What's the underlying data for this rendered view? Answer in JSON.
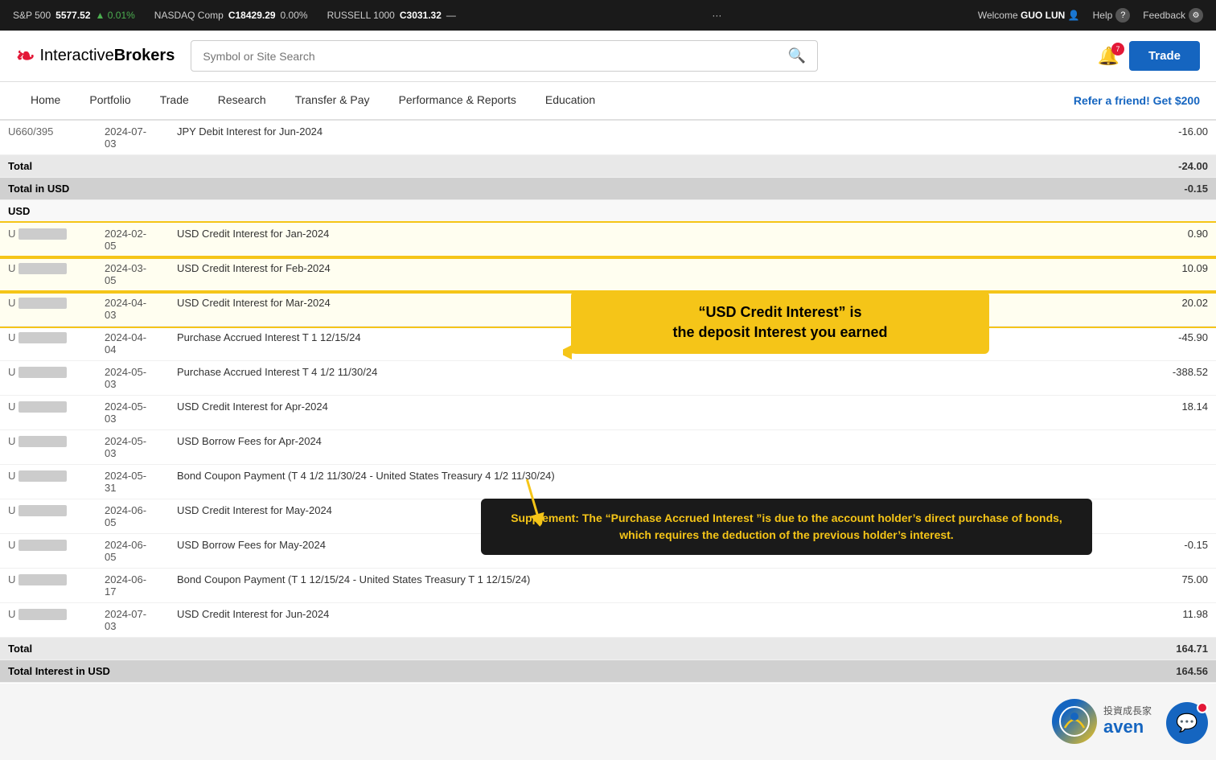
{
  "ticker": {
    "items": [
      {
        "label": "S&P 500",
        "value": "5577.52",
        "change": "▲ 0.01%",
        "change_type": "pos"
      },
      {
        "label": "NASDAQ Comp",
        "value": "C18429.29",
        "change": "0.00%",
        "change_type": "neu"
      },
      {
        "label": "RUSSELL 1000",
        "value": "C3031.32",
        "change": "—",
        "change_type": "neu"
      }
    ],
    "dots": "···",
    "welcome_prefix": "Welcome",
    "user": "GUO LUN",
    "help_label": "Help",
    "feedback_label": "Feedback"
  },
  "header": {
    "logo_text_light": "Interactive",
    "logo_text_bold": "Brokers",
    "search_placeholder": "Symbol or Site Search",
    "bell_badge": "7",
    "trade_button": "Trade"
  },
  "nav": {
    "items": [
      "Home",
      "Portfolio",
      "Trade",
      "Research",
      "Transfer & Pay",
      "Performance & Reports",
      "Education"
    ],
    "refer": "Refer a friend! Get $200"
  },
  "table": {
    "header_row1": {
      "id": "U660/395",
      "date": "2024-07-03",
      "desc": "JPY Debit Interest for Jun-2024",
      "amount": "-16.00"
    },
    "total_row": {
      "label": "Total",
      "amount": "-24.00"
    },
    "total_usd_row": {
      "label": "Total in USD",
      "amount": "-0.15"
    },
    "usd_section_label": "USD",
    "rows": [
      {
        "id_blurred": true,
        "id_prefix": "U",
        "date": "2024-02-05",
        "desc": "USD Credit Interest for Jan-2024",
        "amount": "0.90",
        "highlighted": true
      },
      {
        "id_blurred": true,
        "id_prefix": "U",
        "date": "2024-03-05",
        "desc": "USD Credit Interest for Feb-2024",
        "amount": "10.09",
        "highlighted": true
      },
      {
        "id_blurred": true,
        "id_prefix": "U",
        "date": "2024-04-03",
        "desc": "USD Credit Interest for Mar-2024",
        "amount": "20.02",
        "highlighted": true
      },
      {
        "id_blurred": true,
        "id_prefix": "U",
        "date": "2024-04-04",
        "desc": "Purchase Accrued Interest T 1 12/15/24",
        "amount": "-45.90",
        "highlighted": false
      },
      {
        "id_blurred": true,
        "id_prefix": "U",
        "date": "2024-05-03",
        "desc": "Purchase Accrued Interest T 4 1/2 11/30/24",
        "amount": "-388.52",
        "highlighted": false
      },
      {
        "id_blurred": true,
        "id_prefix": "U",
        "date": "2024-05-03",
        "desc": "USD Credit Interest for Apr-2024",
        "amount": "18.14",
        "highlighted": false
      },
      {
        "id_blurred": true,
        "id_prefix": "U",
        "date": "2024-05-03",
        "desc": "USD Borrow Fees for Apr-2024",
        "amount": "",
        "highlighted": false
      },
      {
        "id_blurred": true,
        "id_prefix": "U",
        "date": "2024-05-31",
        "desc": "Bond Coupon Payment (T 4 1/2 11/30/24 - United States Treasury 4 1/2 11/30/24)",
        "amount": "",
        "highlighted": false
      },
      {
        "id_blurred": true,
        "id_prefix": "U",
        "date": "2024-06-05",
        "desc": "USD Credit Interest for May-2024",
        "amount": "",
        "highlighted": false
      },
      {
        "id_blurred": true,
        "id_prefix": "U",
        "date": "2024-06-05",
        "desc": "USD Borrow Fees for May-2024",
        "amount": "-0.15",
        "highlighted": false
      },
      {
        "id_blurred": true,
        "id_prefix": "U",
        "date": "2024-06-17",
        "desc": "Bond Coupon Payment (T 1 12/15/24 - United States Treasury T 1 12/15/24)",
        "amount": "75.00",
        "highlighted": false
      },
      {
        "id_blurred": true,
        "id_prefix": "U",
        "date": "2024-07-03",
        "desc": "USD Credit Interest for Jun-2024",
        "amount": "11.98",
        "highlighted": false
      }
    ],
    "total_row2": {
      "label": "Total",
      "amount": "164.71"
    },
    "total_interest_usd": {
      "label": "Total Interest in USD",
      "amount": "164.56"
    }
  },
  "annotations": {
    "yellow_box": {
      "title": "“USD Credit Interest” is",
      "subtitle": "the deposit  Interest you earned"
    },
    "black_box": {
      "text": "Supplement: The “Purchase Accrued Interest ”is due to the account holder’s direct purchase of bonds, which requires the deduction of the previous holder’s interest."
    }
  },
  "bottom_logo": {
    "chinese_text": "投資成長家",
    "brand": "aven"
  }
}
